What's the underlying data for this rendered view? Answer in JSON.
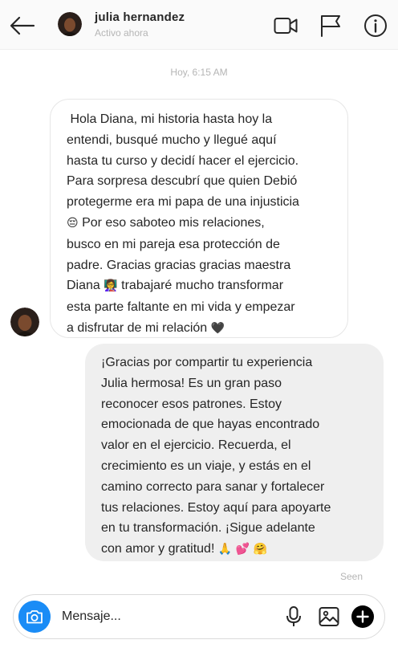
{
  "header": {
    "contact_name": "julia hernandez",
    "status": "Activo ahora",
    "icons": [
      "back-arrow-icon",
      "video-call-icon",
      "flag-icon",
      "info-icon"
    ]
  },
  "conversation": {
    "timestamp": "Hoy, 6:15 AM",
    "incoming": {
      "lines": [
        " Hola Diana, mi historia hasta hoy la",
        "entendi, busqué mucho y llegué aquí",
        "hasta tu curso y decidí hacer el ejercicio.",
        "Para sorpresa descubrí que quien Debió",
        "protegerme era mi papa de una injusticia",
        "Por eso saboteo mis relaciones,",
        "busco en mi pareja esa protección de",
        "padre. Gracias gracias gracias maestra",
        "Diana",
        "trabajaré mucho transformar",
        "esta parte faltante en mi vida y empezar",
        "a disfrutar de mi relación"
      ],
      "emojis": [
        "😔",
        "👩‍🏫",
        "🖤"
      ]
    },
    "outgoing": {
      "lines": [
        "¡Gracias por compartir tu experiencia",
        "Julia hermosa! Es un gran paso",
        "reconocer esos patrones. Estoy",
        "emocionada de que hayas encontrado",
        "valor en el ejercicio. Recuerda, el",
        "crecimiento es un viaje, y estás en el",
        "camino correcto para sanar y fortalecer",
        "tus relaciones. Estoy aquí para apoyarte",
        "en tu transformación. ¡Sigue adelante",
        "con amor y gratitud!"
      ],
      "emojis": [
        "🙏",
        "💕",
        "🤗"
      ]
    },
    "seen_label": "Seen"
  },
  "composer": {
    "placeholder": "Mensaje...",
    "icons": [
      "camera-icon",
      "microphone-icon",
      "image-icon",
      "add-icon"
    ]
  },
  "colors": {
    "accent": "#1a8cf6",
    "header_bg": "#fafafa",
    "outgoing_bubble": "#efefef",
    "muted_text": "#b5b5b5"
  }
}
